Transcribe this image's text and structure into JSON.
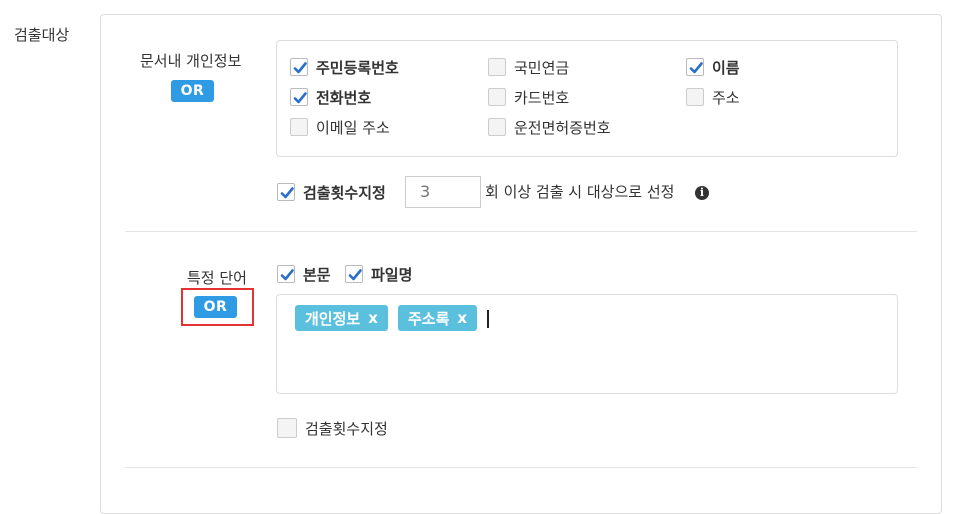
{
  "section": {
    "label": "검출대상"
  },
  "personal_info": {
    "label": "문서내 개인정보",
    "operator": "OR",
    "options": [
      {
        "label": "주민등록번호",
        "checked": true
      },
      {
        "label": "국민연금",
        "checked": false
      },
      {
        "label": "이름",
        "checked": true
      },
      {
        "label": "전화번호",
        "checked": true
      },
      {
        "label": "카드번호",
        "checked": false
      },
      {
        "label": "주소",
        "checked": false
      },
      {
        "label": "이메일 주소",
        "checked": false
      },
      {
        "label": "운전면허증번호",
        "checked": false
      }
    ],
    "count": {
      "checkbox_label": "검출횟수지정",
      "checked": true,
      "value": "3",
      "suffix": "회 이상 검출 시 대상으로 선정",
      "info_icon": "info-icon"
    }
  },
  "specific_words": {
    "label": "특정 단어",
    "operator": "OR",
    "scopes": [
      {
        "label": "본문",
        "checked": true
      },
      {
        "label": "파일명",
        "checked": true
      }
    ],
    "tags": [
      {
        "label": "개인정보",
        "remove": "x"
      },
      {
        "label": "주소록",
        "remove": "x"
      }
    ],
    "count": {
      "checkbox_label": "검출횟수지정",
      "checked": false
    }
  },
  "colors": {
    "operator_badge": "#2f9be4",
    "tag": "#5bc0de",
    "check": "#2a6fc9",
    "highlight": "#e53232"
  }
}
